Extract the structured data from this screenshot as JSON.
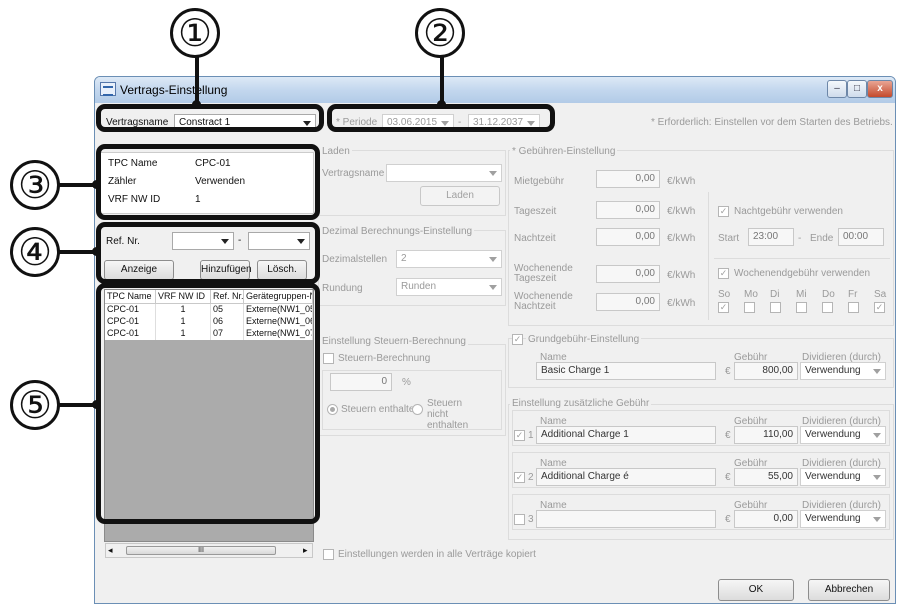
{
  "window": {
    "title": "Vertrags-Einstellung",
    "minimize": "–",
    "maximize": "□",
    "close": "x"
  },
  "callouts": [
    "①",
    "②",
    "③",
    "④",
    "⑤"
  ],
  "top": {
    "contract_label": "Vertragsname",
    "contract_value": "Constract 1",
    "period_label": "* Periode",
    "period_start": "03.06.2015",
    "period_dash": "-",
    "period_end": "31.12.2037",
    "required_note": "* Erforderlich: Einstellen vor dem Starten des Betriebs."
  },
  "info": {
    "tpc_label": "TPC Name",
    "tpc_value": "CPC-01",
    "counter_label": "Zähler",
    "counter_value": "Verwenden",
    "vrf_label": "VRF NW ID",
    "vrf_value": "1"
  },
  "ref": {
    "label": "Ref. Nr.",
    "dash": "-",
    "show_btn": "Anzeige",
    "add_btn": "Hinzufügen",
    "del_btn": "Lösch."
  },
  "table": {
    "headers": [
      "TPC Name",
      "VRF NW ID",
      "Ref. Nr.",
      "Gerätegruppen-N"
    ],
    "rows": [
      [
        "CPC-01",
        "1",
        "05",
        "Externe(NW1_05"
      ],
      [
        "CPC-01",
        "1",
        "06",
        "Externe(NW1_06"
      ],
      [
        "CPC-01",
        "1",
        "07",
        "Externe(NW1_07"
      ]
    ],
    "scroll_thumb": "III",
    "scroll_left": "◂",
    "scroll_right": "▸"
  },
  "load": {
    "title": "Laden",
    "contract_label": "Vertragsname",
    "load_btn": "Laden"
  },
  "decimal": {
    "title": "Dezimal Berechnungs-Einstellung",
    "places_label": "Dezimalstellen",
    "places_value": "2",
    "rounding_label": "Rundung",
    "rounding_value": "Runden"
  },
  "tax": {
    "title": "Einstellung Steuern-Berechnung",
    "calc_label": "Steuern-Berechnung",
    "percent_value": "0",
    "percent_unit": "%",
    "included": "Steuern enthalten",
    "not_included": "Steuern nicht enthalten"
  },
  "copy_label": "Einstellungen werden in alle Verträge kopiert",
  "fees": {
    "title": "* Gebühren-Einstellung",
    "rent_label": "Mietgebühr",
    "rent_value": "0,00",
    "unit": "€/kWh",
    "day_label": "Tageszeit",
    "day_value": "0,00",
    "night_label": "Nachtzeit",
    "night_value": "0,00",
    "we_day_label": "Wochenende Tageszeit",
    "we_day_value": "0,00",
    "we_night_label": "Wochenende Nachtzeit",
    "we_night_value": "0,00",
    "night_use_label": "Nachtgebühr verwenden",
    "start_label": "Start",
    "start_value": "23:00",
    "end_dash": "-",
    "end_label": "Ende",
    "end_value": "00:00",
    "weekend_use_label": "Wochenendgebühr verwenden",
    "days": [
      "So",
      "Mo",
      "Di",
      "Mi",
      "Do",
      "Fr",
      "Sa"
    ],
    "days_checked": [
      true,
      false,
      false,
      false,
      false,
      false,
      true
    ]
  },
  "basic": {
    "title": "Grundgebühr-Einstellung",
    "name_label": "Name",
    "name_value": "Basic Charge 1",
    "fee_label": "Gebühr",
    "currency": "€",
    "fee_value": "800,00",
    "divide_label": "Dividieren (durch)",
    "divide_value": "Verwendung"
  },
  "additional": {
    "title": "Einstellung zusätzliche Gebühr",
    "name_label": "Name",
    "fee_label": "Gebühr",
    "divide_label": "Dividieren (durch)",
    "currency": "€",
    "items": [
      {
        "index": "1",
        "checked": true,
        "name": "Additional Charge 1",
        "fee": "110,00",
        "divide": "Verwendung"
      },
      {
        "index": "2",
        "checked": true,
        "name": "Additional Charge é",
        "fee": "55,00",
        "divide": "Verwendung"
      },
      {
        "index": "3",
        "checked": false,
        "name": "",
        "fee": "0,00",
        "divide": "Verwendung"
      }
    ]
  },
  "footer": {
    "ok": "OK",
    "cancel": "Abbrechen"
  }
}
